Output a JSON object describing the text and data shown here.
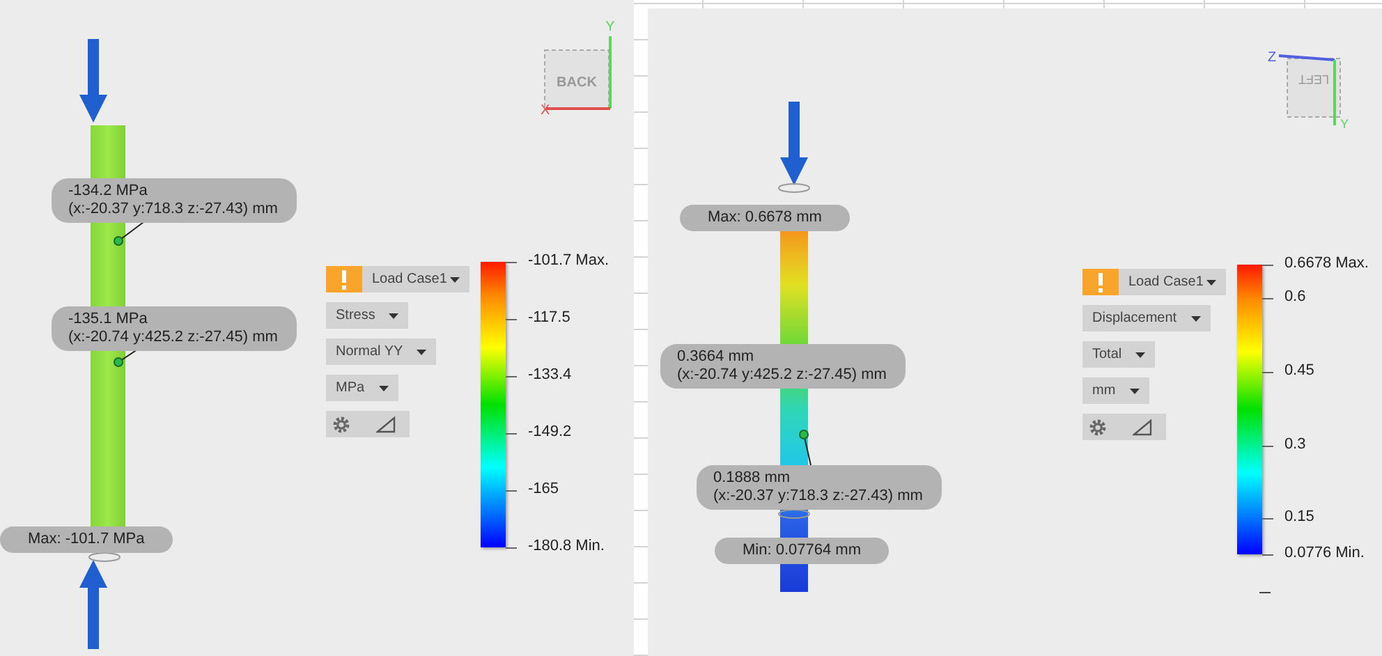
{
  "panels": [
    {
      "view_cube": {
        "face": "BACK",
        "axes": [
          "Y",
          "X"
        ]
      },
      "markers": [
        {
          "kind": "probe",
          "value": "-134.2 MPa",
          "location": "(x:-20.37 y:718.3 z:-27.43) mm"
        },
        {
          "kind": "probe",
          "value": "-135.1 MPa",
          "location": "(x:-20.74 y:425.2 z:-27.45) mm"
        },
        {
          "kind": "extreme",
          "value": "Max: -101.7 MPa"
        }
      ],
      "legend": {
        "load_case": "Load Case1",
        "result": "Stress",
        "component": "Normal YY",
        "unit": "MPa",
        "ticks": [
          "-101.7 Max.",
          "-117.5",
          "-133.4",
          "-149.2",
          "-165",
          "-180.8 Min."
        ]
      }
    },
    {
      "view_cube": {
        "face": "LEFT",
        "axes": [
          "Z",
          "Y"
        ]
      },
      "markers": [
        {
          "kind": "extreme",
          "value": "Max: 0.6678 mm"
        },
        {
          "kind": "probe",
          "value": "0.3664 mm",
          "location": "(x:-20.74 y:425.2 z:-27.45) mm"
        },
        {
          "kind": "probe",
          "value": "0.1888 mm",
          "location": "(x:-20.37 y:718.3 z:-27.43) mm"
        },
        {
          "kind": "extreme",
          "value": "Min: 0.07764 mm"
        }
      ],
      "legend": {
        "load_case": "Load Case1",
        "result": "Displacement",
        "component": "Total",
        "unit": "mm",
        "ticks": [
          "0.6678 Max.",
          "0.6",
          "0.45",
          "0.3",
          "0.15",
          "0.0776 Min."
        ]
      }
    }
  ]
}
